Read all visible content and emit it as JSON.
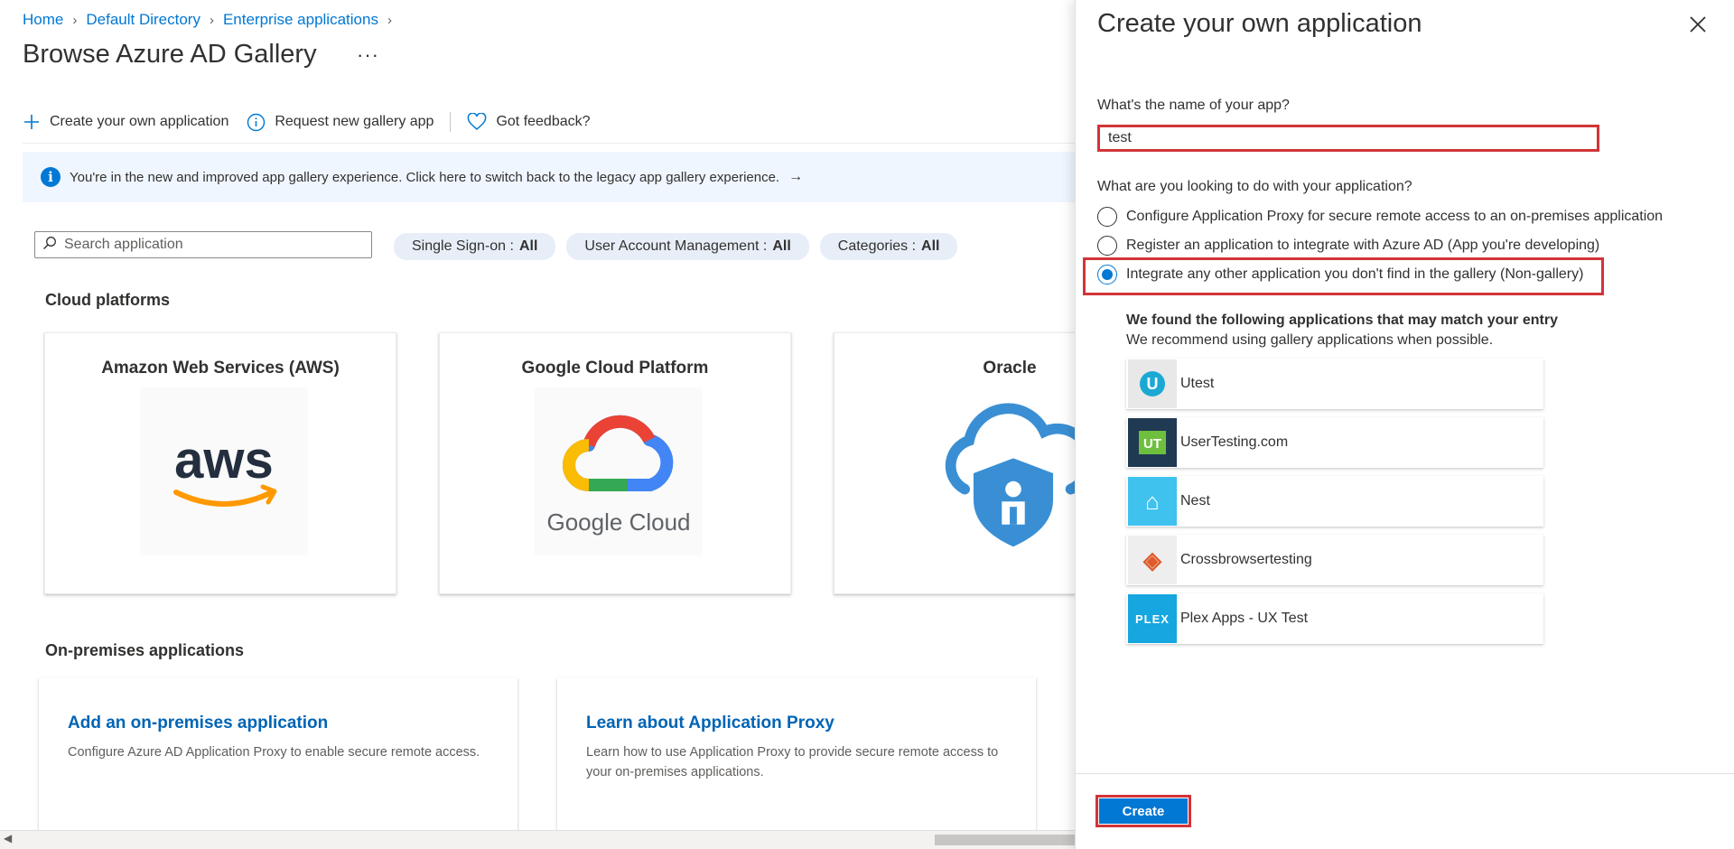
{
  "breadcrumb": [
    "Home",
    "Default Directory",
    "Enterprise applications"
  ],
  "page_title": "Browse Azure AD Gallery",
  "more_label": "···",
  "toolbar": {
    "create_label": "Create your own application",
    "request_label": "Request new gallery app",
    "feedback_label": "Got feedback?"
  },
  "banner": {
    "text": "You're in the new and improved app gallery experience. Click here to switch back to the legacy app gallery experience."
  },
  "search": {
    "placeholder": "Search application"
  },
  "filters": [
    {
      "label": "Single Sign-on :",
      "value": "All"
    },
    {
      "label": "User Account Management :",
      "value": "All"
    },
    {
      "label": "Categories :",
      "value": "All"
    }
  ],
  "cloud_section": {
    "title": "Cloud platforms",
    "cards": [
      {
        "title": "Amazon Web Services (AWS)",
        "logo_text": "aws"
      },
      {
        "title": "Google Cloud Platform",
        "logo_text": "Google Cloud"
      },
      {
        "title": "Oracle"
      }
    ]
  },
  "onprem_section": {
    "title": "On-premises applications",
    "cards": [
      {
        "title": "Add an on-premises application",
        "desc": "Configure Azure AD Application Proxy to enable secure remote access."
      },
      {
        "title": "Learn about Application Proxy",
        "desc": "Learn how to use Application Proxy to provide secure remote access to your on-premises applications."
      }
    ]
  },
  "panel": {
    "title": "Create your own application",
    "name_question": "What's the name of your app?",
    "name_value": "test",
    "purpose_question": "What are you looking to do with your application?",
    "options": [
      {
        "label": "Configure Application Proxy for secure remote access to an on-premises application",
        "checked": false
      },
      {
        "label": "Register an application to integrate with Azure AD (App you're developing)",
        "checked": false
      },
      {
        "label": "Integrate any other application you don't find in the gallery (Non-gallery)",
        "checked": true
      }
    ],
    "found_title": "We found the following applications that may match your entry",
    "found_subtitle": "We recommend using gallery applications when possible.",
    "suggestions": [
      {
        "name": "Utest",
        "logo_text": "U",
        "logo_bg": "#e8e8e8",
        "logo_fg": "#1ba9d4"
      },
      {
        "name": "UserTesting.com",
        "logo_text": "UT",
        "logo_bg": "#1f3a52",
        "logo_fg": "#6fbf3f"
      },
      {
        "name": "Nest",
        "logo_text": "⌂",
        "logo_bg": "#3fc2ee",
        "logo_fg": "#ffffff"
      },
      {
        "name": "Crossbrowsertesting",
        "logo_text": "◈",
        "logo_bg": "#eeeeee",
        "logo_fg": "#e05a2b"
      },
      {
        "name": "Plex Apps - UX Test",
        "logo_text": "PLEX",
        "logo_bg": "#16a6e0",
        "logo_fg": "#ffffff"
      }
    ],
    "create_label": "Create"
  },
  "colors": {
    "accent": "#0078d4",
    "highlight": "#d13438",
    "banner_bg": "#f0f6ff"
  }
}
